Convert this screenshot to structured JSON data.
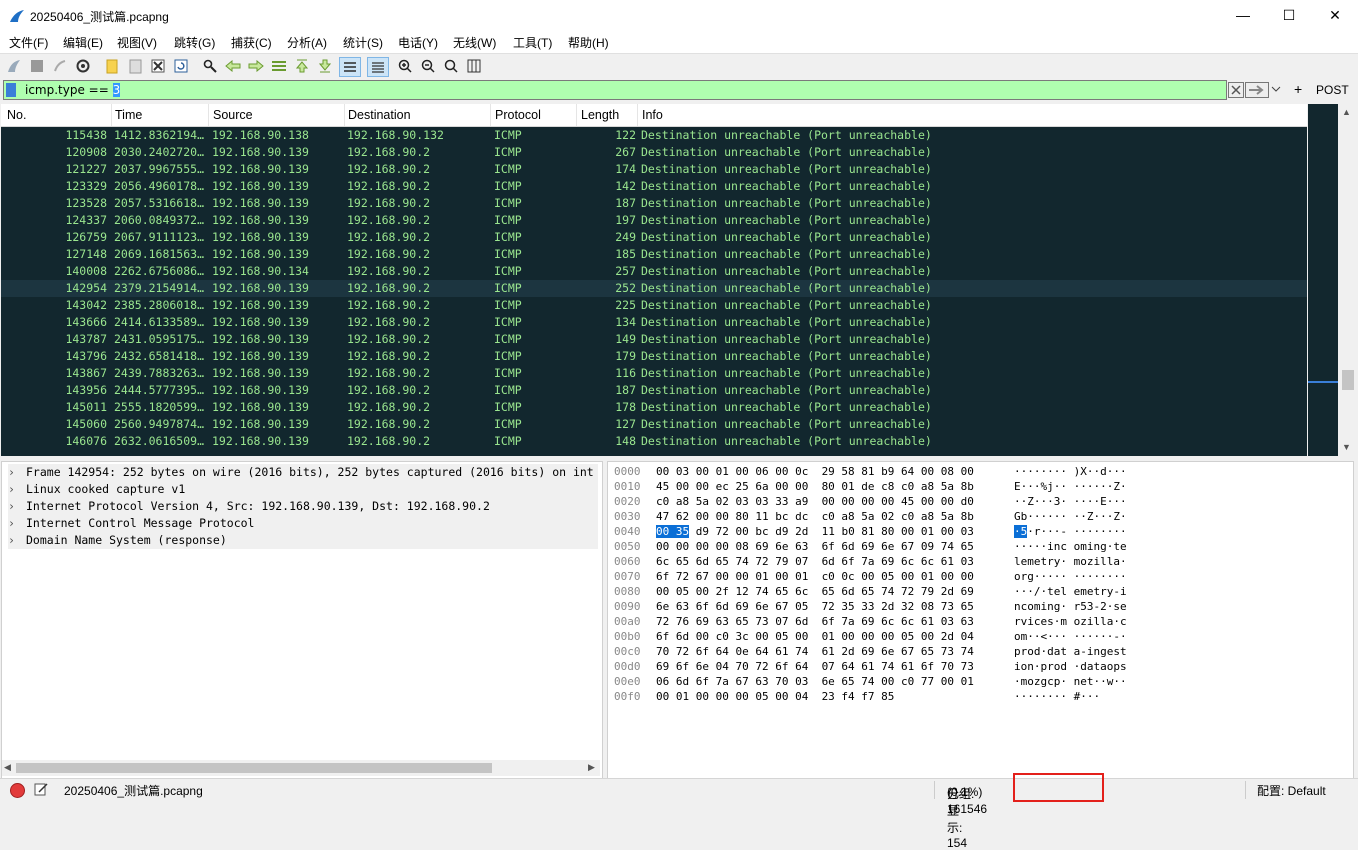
{
  "window": {
    "title": "20250406_测试篇.pcapng",
    "min": "—",
    "max": "☐",
    "close": "✕"
  },
  "menu": [
    "文件(F)",
    "编辑(E)",
    "视图(V)",
    "跳转(G)",
    "捕获(C)",
    "分析(A)",
    "统计(S)",
    "电话(Y)",
    "无线(W)",
    "工具(T)",
    "帮助(H)"
  ],
  "filter": {
    "text": "icmp.type == ",
    "selected": "3",
    "plus": "+",
    "post": "POST"
  },
  "columns": [
    "No.",
    "Time",
    "Source",
    "Destination",
    "Protocol",
    "Length",
    "Info"
  ],
  "packets": [
    {
      "no": "115438",
      "time": "1412.8362194…",
      "src": "192.168.90.138",
      "dst": "192.168.90.132",
      "proto": "ICMP",
      "len": "122",
      "info": "Destination unreachable (Port unreachable)"
    },
    {
      "no": "120908",
      "time": "2030.2402720…",
      "src": "192.168.90.139",
      "dst": "192.168.90.2",
      "proto": "ICMP",
      "len": "267",
      "info": "Destination unreachable (Port unreachable)"
    },
    {
      "no": "121227",
      "time": "2037.9967555…",
      "src": "192.168.90.139",
      "dst": "192.168.90.2",
      "proto": "ICMP",
      "len": "174",
      "info": "Destination unreachable (Port unreachable)"
    },
    {
      "no": "123329",
      "time": "2056.4960178…",
      "src": "192.168.90.139",
      "dst": "192.168.90.2",
      "proto": "ICMP",
      "len": "142",
      "info": "Destination unreachable (Port unreachable)"
    },
    {
      "no": "123528",
      "time": "2057.5316618…",
      "src": "192.168.90.139",
      "dst": "192.168.90.2",
      "proto": "ICMP",
      "len": "187",
      "info": "Destination unreachable (Port unreachable)"
    },
    {
      "no": "124337",
      "time": "2060.0849372…",
      "src": "192.168.90.139",
      "dst": "192.168.90.2",
      "proto": "ICMP",
      "len": "197",
      "info": "Destination unreachable (Port unreachable)"
    },
    {
      "no": "126759",
      "time": "2067.9111123…",
      "src": "192.168.90.139",
      "dst": "192.168.90.2",
      "proto": "ICMP",
      "len": "249",
      "info": "Destination unreachable (Port unreachable)"
    },
    {
      "no": "127148",
      "time": "2069.1681563…",
      "src": "192.168.90.139",
      "dst": "192.168.90.2",
      "proto": "ICMP",
      "len": "185",
      "info": "Destination unreachable (Port unreachable)"
    },
    {
      "no": "140008",
      "time": "2262.6756086…",
      "src": "192.168.90.134",
      "dst": "192.168.90.2",
      "proto": "ICMP",
      "len": "257",
      "info": "Destination unreachable (Port unreachable)"
    },
    {
      "no": "142954",
      "time": "2379.2154914…",
      "src": "192.168.90.139",
      "dst": "192.168.90.2",
      "proto": "ICMP",
      "len": "252",
      "info": "Destination unreachable (Port unreachable)"
    },
    {
      "no": "143042",
      "time": "2385.2806018…",
      "src": "192.168.90.139",
      "dst": "192.168.90.2",
      "proto": "ICMP",
      "len": "225",
      "info": "Destination unreachable (Port unreachable)"
    },
    {
      "no": "143666",
      "time": "2414.6133589…",
      "src": "192.168.90.139",
      "dst": "192.168.90.2",
      "proto": "ICMP",
      "len": "134",
      "info": "Destination unreachable (Port unreachable)"
    },
    {
      "no": "143787",
      "time": "2431.0595175…",
      "src": "192.168.90.139",
      "dst": "192.168.90.2",
      "proto": "ICMP",
      "len": "149",
      "info": "Destination unreachable (Port unreachable)"
    },
    {
      "no": "143796",
      "time": "2432.6581418…",
      "src": "192.168.90.139",
      "dst": "192.168.90.2",
      "proto": "ICMP",
      "len": "179",
      "info": "Destination unreachable (Port unreachable)"
    },
    {
      "no": "143867",
      "time": "2439.7883263…",
      "src": "192.168.90.139",
      "dst": "192.168.90.2",
      "proto": "ICMP",
      "len": "116",
      "info": "Destination unreachable (Port unreachable)"
    },
    {
      "no": "143956",
      "time": "2444.5777395…",
      "src": "192.168.90.139",
      "dst": "192.168.90.2",
      "proto": "ICMP",
      "len": "187",
      "info": "Destination unreachable (Port unreachable)"
    },
    {
      "no": "145011",
      "time": "2555.1820599…",
      "src": "192.168.90.139",
      "dst": "192.168.90.2",
      "proto": "ICMP",
      "len": "178",
      "info": "Destination unreachable (Port unreachable)"
    },
    {
      "no": "145060",
      "time": "2560.9497874…",
      "src": "192.168.90.139",
      "dst": "192.168.90.2",
      "proto": "ICMP",
      "len": "127",
      "info": "Destination unreachable (Port unreachable)"
    },
    {
      "no": "146076",
      "time": "2632.0616509…",
      "src": "192.168.90.139",
      "dst": "192.168.90.2",
      "proto": "ICMP",
      "len": "148",
      "info": "Destination unreachable (Port unreachable)"
    }
  ],
  "selected_packet": "142954",
  "details": [
    "Frame 142954: 252 bytes on wire (2016 bits), 252 bytes captured (2016 bits) on int",
    "Linux cooked capture v1",
    "Internet Protocol Version 4, Src: 192.168.90.139, Dst: 192.168.90.2",
    "Internet Control Message Protocol",
    "Domain Name System (response)"
  ],
  "hex": [
    {
      "off": "0000",
      "hex": "00 03 00 01 00 06 00 0c  29 58 81 b9 64 00 08 00",
      "ascii": "········ )X··d···"
    },
    {
      "off": "0010",
      "hex": "45 00 00 ec 25 6a 00 00  80 01 de c8 c0 a8 5a 8b",
      "ascii": "E···%j·· ······Z·"
    },
    {
      "off": "0020",
      "hex": "c0 a8 5a 02 03 03 33 a9  00 00 00 00 45 00 00 d0",
      "ascii": "··Z···3· ····E···"
    },
    {
      "off": "0030",
      "hex": "47 62 00 00 80 11 bc dc  c0 a8 5a 02 c0 a8 5a 8b",
      "ascii": "Gb······ ··Z···Z·"
    },
    {
      "off": "0040",
      "hl": "00 35",
      "hex": " d9 72 00 bc d9 2d  11 b0 81 80 00 01 00 03",
      "hlascii": "·5",
      "ascii": "·r···- ········"
    },
    {
      "off": "0050",
      "hex": "00 00 00 00 08 69 6e 63  6f 6d 69 6e 67 09 74 65",
      "ascii": "·····inc oming·te"
    },
    {
      "off": "0060",
      "hex": "6c 65 6d 65 74 72 79 07  6d 6f 7a 69 6c 6c 61 03",
      "ascii": "lemetry· mozilla·"
    },
    {
      "off": "0070",
      "hex": "6f 72 67 00 00 01 00 01  c0 0c 00 05 00 01 00 00",
      "ascii": "org····· ········"
    },
    {
      "off": "0080",
      "hex": "00 05 00 2f 12 74 65 6c  65 6d 65 74 72 79 2d 69",
      "ascii": "···/·tel emetry-i"
    },
    {
      "off": "0090",
      "hex": "6e 63 6f 6d 69 6e 67 05  72 35 33 2d 32 08 73 65",
      "ascii": "ncoming· r53-2·se"
    },
    {
      "off": "00a0",
      "hex": "72 76 69 63 65 73 07 6d  6f 7a 69 6c 6c 61 03 63",
      "ascii": "rvices·m ozilla·c"
    },
    {
      "off": "00b0",
      "hex": "6f 6d 00 c0 3c 00 05 00  01 00 00 00 05 00 2d 04",
      "ascii": "om··<··· ······-·"
    },
    {
      "off": "00c0",
      "hex": "70 72 6f 64 0e 64 61 74  61 2d 69 6e 67 65 73 74",
      "ascii": "prod·dat a-ingest"
    },
    {
      "off": "00d0",
      "hex": "69 6f 6e 04 70 72 6f 64  07 64 61 74 61 6f 70 73",
      "ascii": "ion·prod ·dataops"
    },
    {
      "off": "00e0",
      "hex": "06 6d 6f 7a 67 63 70 03  6e 65 74 00 c0 77 00 01",
      "ascii": "·mozgcp· net··w··"
    },
    {
      "off": "00f0",
      "hex": "00 01 00 00 00 05 00 04  23 f4 f7 85",
      "ascii": "········ #···"
    }
  ],
  "status": {
    "file": "20250406_测试篇.pcapng",
    "stats_pre": "分组: 161546 · ",
    "stats_hl": "已显示: 154",
    "stats_post": "(0.1%)",
    "profile": "配置: Default"
  },
  "colors": {
    "packet_bg": "#12272e",
    "packet_fg": "#9ae68f",
    "filter_ok": "#afffaf",
    "highlight_box": "#e3201b"
  }
}
